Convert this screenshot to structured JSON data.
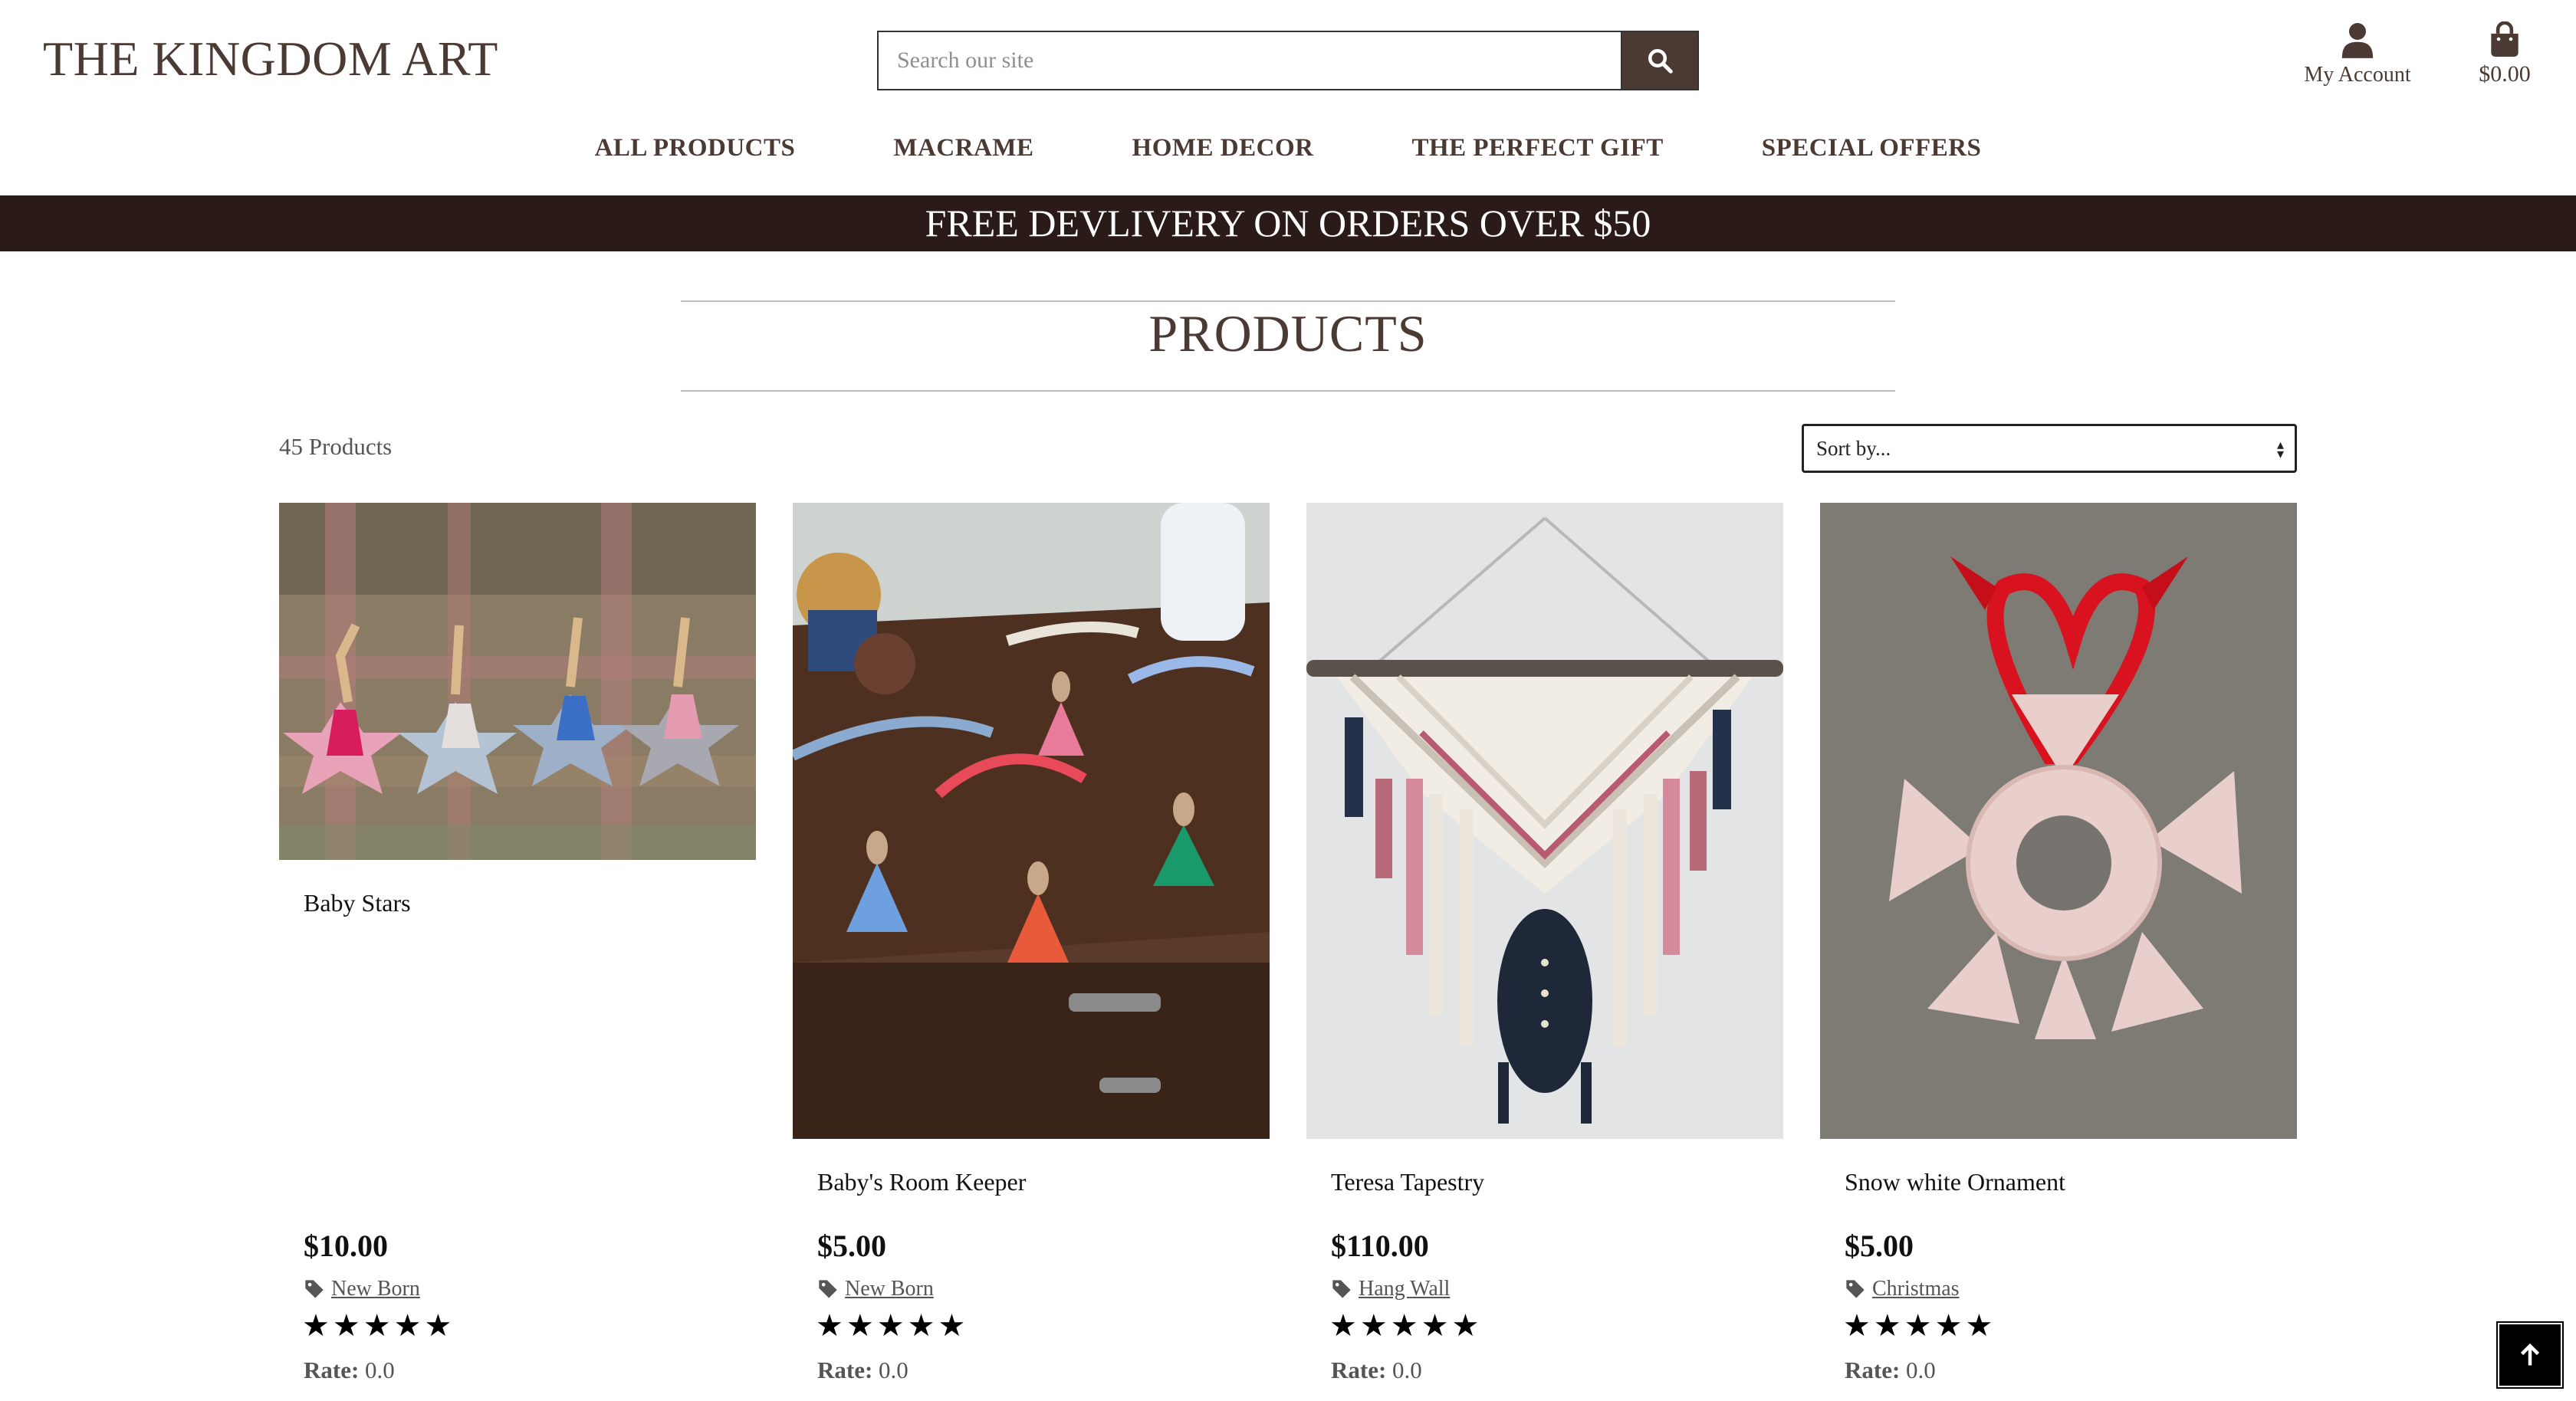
{
  "brand": "THE KINGDOM ART",
  "search": {
    "placeholder": "Search our site"
  },
  "account": {
    "label": "My Account"
  },
  "bag": {
    "total": "$0.00"
  },
  "nav": [
    {
      "label": "ALL PRODUCTS"
    },
    {
      "label": "MACRAME"
    },
    {
      "label": "HOME DECOR"
    },
    {
      "label": "THE PERFECT GIFT"
    },
    {
      "label": "SPECIAL OFFERS"
    }
  ],
  "banner": "FREE DEVLIVERY ON ORDERS OVER $50",
  "page_title": "PRODUCTS",
  "product_count": "45 Products",
  "sort": {
    "selected": "Sort by..."
  },
  "rate_label": "Rate:",
  "products": [
    {
      "name": "Baby Stars",
      "price": "$10.00",
      "category": "New Born",
      "stars": "★★★★★",
      "rate": "0.0",
      "image": "baby-stars-photo"
    },
    {
      "name": "Baby's Room Keeper",
      "price": "$5.00",
      "category": "New Born",
      "stars": "★★★★★",
      "rate": "0.0",
      "image": "bunny-ornaments-photo"
    },
    {
      "name": "Teresa Tapestry",
      "price": "$110.00",
      "category": "Hang Wall",
      "stars": "★★★★★",
      "rate": "0.0",
      "image": "macrame-tapestry-photo"
    },
    {
      "name": "Snow white Ornament",
      "price": "$5.00",
      "category": "Christmas",
      "stars": "★★★★★",
      "rate": "0.0",
      "image": "snowflake-ornament-photo"
    }
  ],
  "colors": {
    "brand_brown": "#4a3a33",
    "banner_bg": "#2a1a18"
  }
}
